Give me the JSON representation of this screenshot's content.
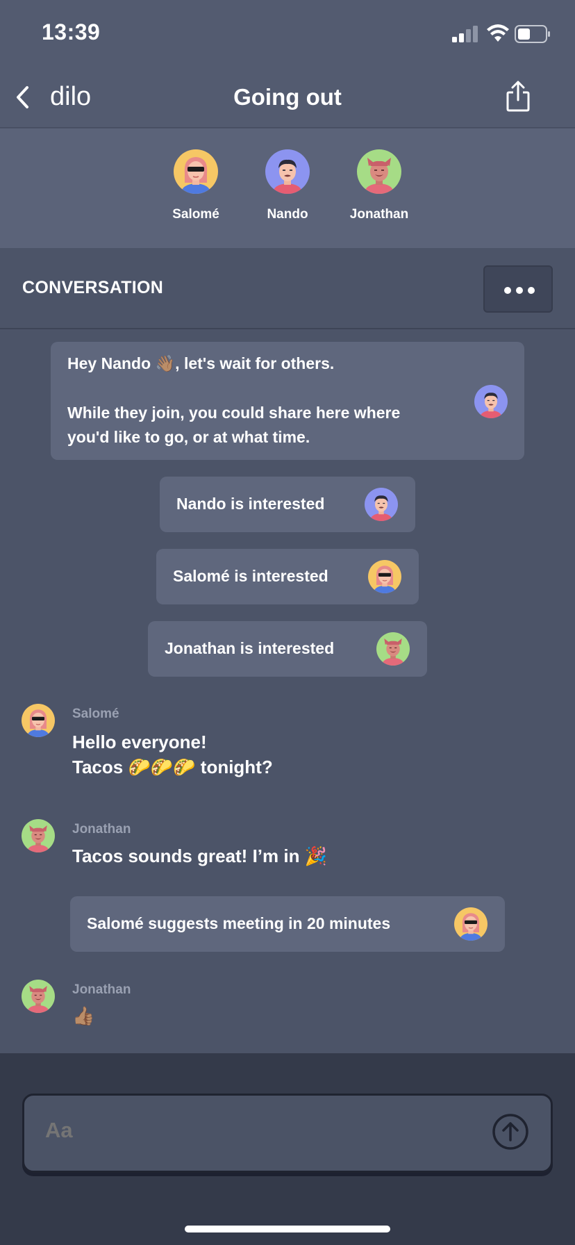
{
  "status": {
    "time": "13:39"
  },
  "nav": {
    "back_label": "dilo",
    "title": "Going out"
  },
  "participants": [
    {
      "name": "Salomé"
    },
    {
      "name": "Nando"
    },
    {
      "name": "Jonathan"
    }
  ],
  "section": {
    "title": "CONVERSATION"
  },
  "system_message": {
    "line1": "Hey Nando 👋🏽, let's wait for others.",
    "line2": "While they join, you could share here where",
    "line3": "you'd like to go, or at what time."
  },
  "events": [
    {
      "text": "Nando is interested"
    },
    {
      "text": "Salomé is interested"
    },
    {
      "text": "Jonathan is interested"
    }
  ],
  "messages": [
    {
      "author": "Salomé",
      "lines": [
        "Hello everyone!",
        "Tacos 🌮🌮🌮 tonight?"
      ]
    },
    {
      "author": "Jonathan",
      "lines": [
        "Tacos sounds great! I’m in 🎉"
      ]
    },
    {
      "author": "Jonathan",
      "lines": [
        "👍🏽"
      ]
    }
  ],
  "suggestion": {
    "text": "Salomé suggests meeting in 20 minutes"
  },
  "composer": {
    "placeholder": "Aa"
  },
  "colors": {
    "background": "#4c5468",
    "header": "#535b70",
    "participants_bar": "#5b6379",
    "bubble": "#5f677d",
    "composer": "#343a4a",
    "avatar_salome_bg": "#f6c765",
    "avatar_nando_bg": "#8c94f0",
    "avatar_jonathan_bg": "#a6dc86"
  },
  "icons": [
    "signal-icon",
    "wifi-icon",
    "battery-icon",
    "back-chevron-icon",
    "share-icon",
    "more-dots-icon",
    "send-arrow-icon"
  ]
}
